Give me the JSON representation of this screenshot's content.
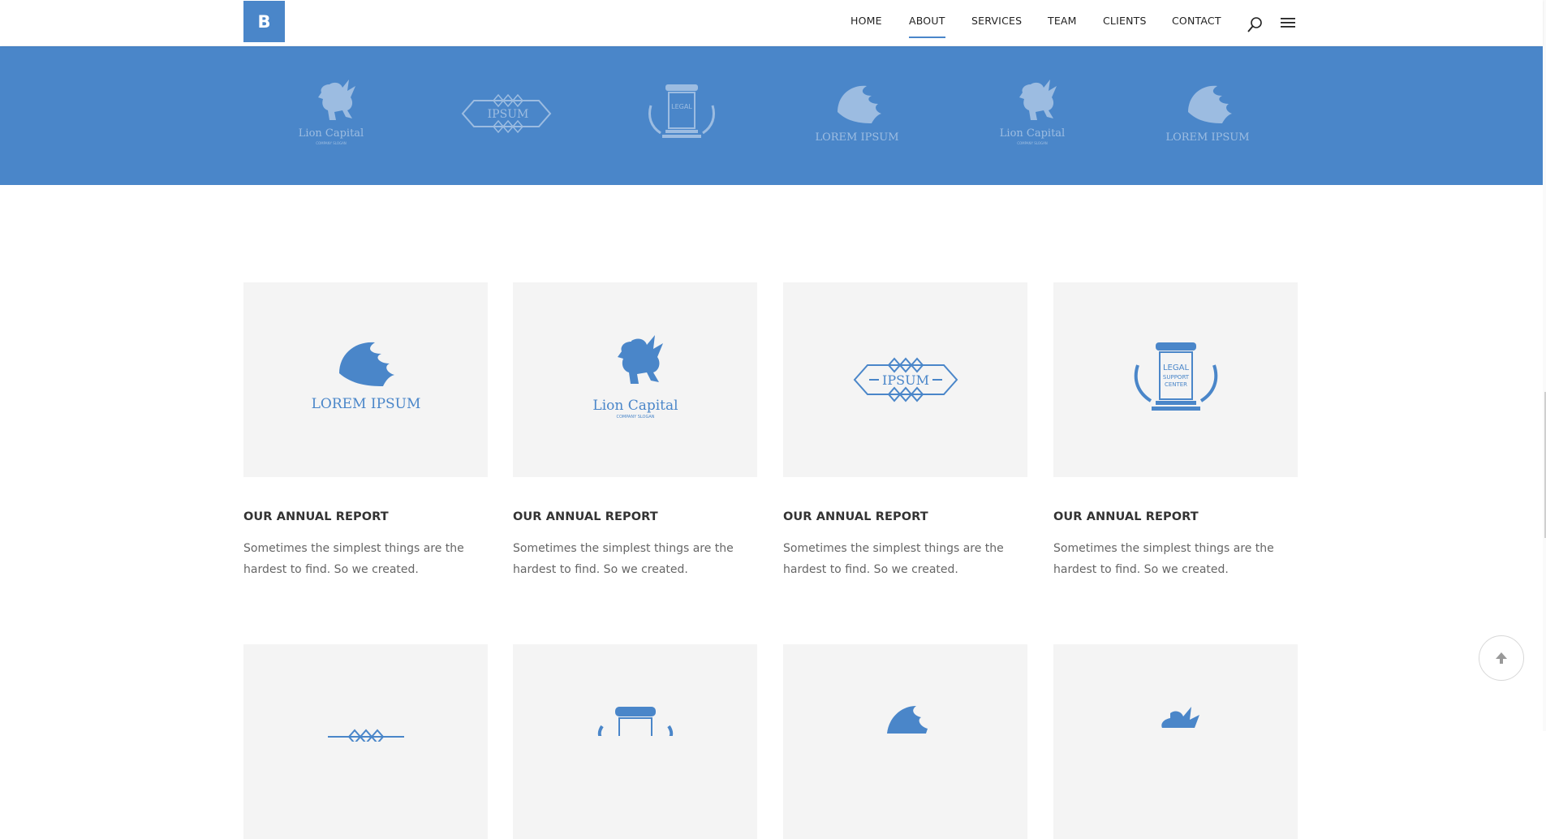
{
  "header": {
    "logo_letter": "B",
    "nav": [
      {
        "label": "HOME",
        "active": false
      },
      {
        "label": "ABOUT",
        "active": true
      },
      {
        "label": "SERVICES",
        "active": false
      },
      {
        "label": "TEAM",
        "active": false
      },
      {
        "label": "CLIENTS",
        "active": false
      },
      {
        "label": "CONTACT",
        "active": false
      }
    ],
    "icons": [
      "search-icon",
      "hamburger-menu-icon"
    ]
  },
  "band": {
    "color": "#4a86c9",
    "logos": [
      {
        "icon": "lion-capital-logo",
        "text": "Lion Capital",
        "sub": "COMPANY SLOGAN"
      },
      {
        "icon": "ipsum-diamond-logo",
        "text": "IPSUM"
      },
      {
        "icon": "legal-column-logo",
        "text": "LEGAL"
      },
      {
        "icon": "shell-lion-logo",
        "text": "LOREM IPSUM"
      },
      {
        "icon": "lion-capital-logo",
        "text": "Lion Capital",
        "sub": "COMPANY SLOGAN"
      },
      {
        "icon": "shell-lion-logo",
        "text": "LOREM IPSUM"
      }
    ]
  },
  "cards": [
    {
      "icon": "shell-lion-logo",
      "logo_text": "LOREM IPSUM",
      "title": "OUR ANNUAL REPORT",
      "text": "Sometimes the simplest things are the hardest to find. So we created."
    },
    {
      "icon": "lion-capital-logo",
      "logo_text": "Lion Capital",
      "logo_sub": "COMPANY SLOGAN",
      "title": "OUR ANNUAL REPORT",
      "text": "Sometimes the simplest things are the hardest to find. So we created."
    },
    {
      "icon": "ipsum-diamond-logo",
      "logo_text": "IPSUM",
      "title": "OUR ANNUAL REPORT",
      "text": "Sometimes the simplest things are the hardest to find. So we created."
    },
    {
      "icon": "legal-column-logo",
      "logo_text": "LEGAL",
      "logo_sub": "SUPPORT",
      "logo_sub2": "CENTER",
      "title": "OUR ANNUAL REPORT",
      "text": "Sometimes the simplest things are the hardest to find. So we created."
    }
  ],
  "accent_color": "#4a86c9",
  "back_to_top_icon": "arrow-up-icon"
}
